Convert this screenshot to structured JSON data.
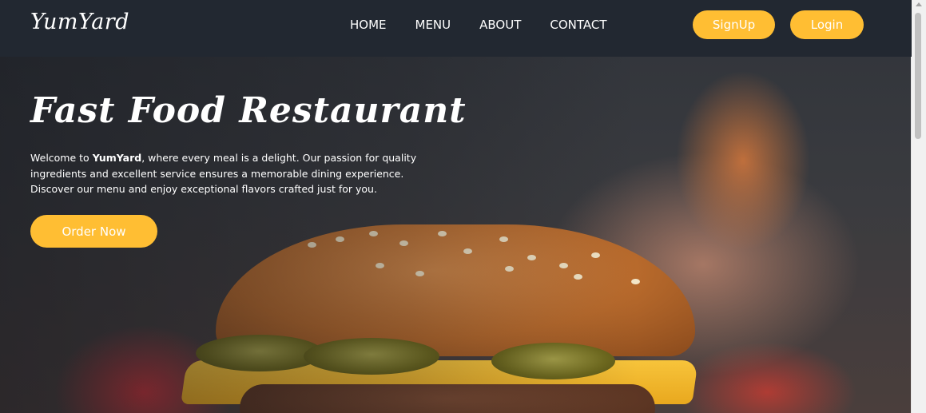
{
  "header": {
    "logo": "YumYard",
    "nav": [
      "HOME",
      "MENU",
      "ABOUT",
      "CONTACT"
    ],
    "signup_label": "SignUp",
    "login_label": "Login"
  },
  "hero": {
    "title": "Fast Food Restaurant",
    "text_before": "Welcome to ",
    "text_brand": "YumYard",
    "text_after": ", where every meal is a delight. Our passion for quality ingredients and excellent service ensures a memorable dining experience. Discover our menu and enjoy exceptional flavors crafted just for you.",
    "order_label": "Order Now",
    "image": "burger-photo"
  },
  "colors": {
    "header_bg": "#222831",
    "accent": "#ffbe33",
    "text": "#ffffff"
  }
}
